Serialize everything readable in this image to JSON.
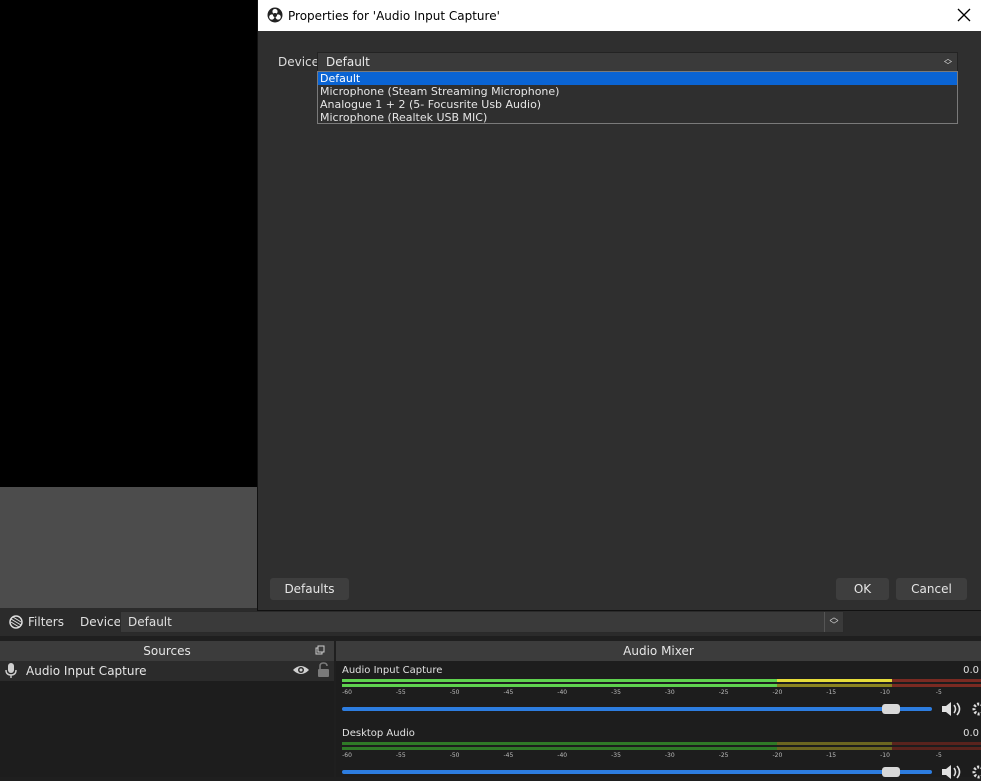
{
  "dialog": {
    "title": "Properties for 'Audio Input Capture'",
    "device_label": "Device",
    "device_value": "Default",
    "options": [
      "Default",
      "Microphone (Steam Streaming Microphone)",
      "Analogue 1 + 2 (5- Focusrite Usb Audio)",
      "Microphone (Realtek USB MIC)"
    ],
    "selected_index": 0,
    "defaults_label": "Defaults",
    "ok_label": "OK",
    "cancel_label": "Cancel"
  },
  "context_bar": {
    "filters_label": "Filters",
    "device_label": "Device",
    "device_value": "Default"
  },
  "sources": {
    "title": "Sources",
    "items": [
      {
        "name": "Audio Input Capture"
      }
    ]
  },
  "mixer": {
    "title": "Audio Mixer",
    "ticks": [
      "-60",
      "-55",
      "-50",
      "-45",
      "-40",
      "-35",
      "-30",
      "-25",
      "-20",
      "-15",
      "-10",
      "-5"
    ],
    "channels": [
      {
        "name": "Audio Input Capture",
        "db": "0.0",
        "level": 0.93
      },
      {
        "name": "Desktop Audio",
        "db": "0.0",
        "level": 0.93
      }
    ]
  },
  "colors": {
    "accent": "#2d7de0",
    "selection": "#0a64d4",
    "meter_green": "#5fd24f",
    "meter_yellow": "#e6dc3a",
    "meter_red": "#c03b2b"
  }
}
